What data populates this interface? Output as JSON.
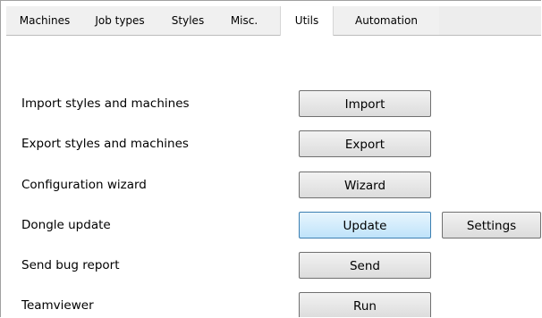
{
  "tabs": [
    {
      "label": "Machines",
      "active": false
    },
    {
      "label": "Job types",
      "active": false
    },
    {
      "label": "Styles",
      "active": false
    },
    {
      "label": "Misc.",
      "active": false
    },
    {
      "label": "Utils",
      "active": true
    },
    {
      "label": "Automation",
      "active": false
    }
  ],
  "rows": [
    {
      "label": "Import styles and machines",
      "button": "Import"
    },
    {
      "label": "Export styles and machines",
      "button": "Export"
    },
    {
      "label": "Configuration wizard",
      "button": "Wizard"
    },
    {
      "label": "Dongle update",
      "button": "Update",
      "extra_button": "Settings"
    },
    {
      "label": "Send bug report",
      "button": "Send"
    },
    {
      "label": "Teamviewer",
      "button": "Run"
    }
  ],
  "colors": {
    "highlight_border": "#3c7fb1",
    "highlight_fill": "#bfe3fa"
  }
}
